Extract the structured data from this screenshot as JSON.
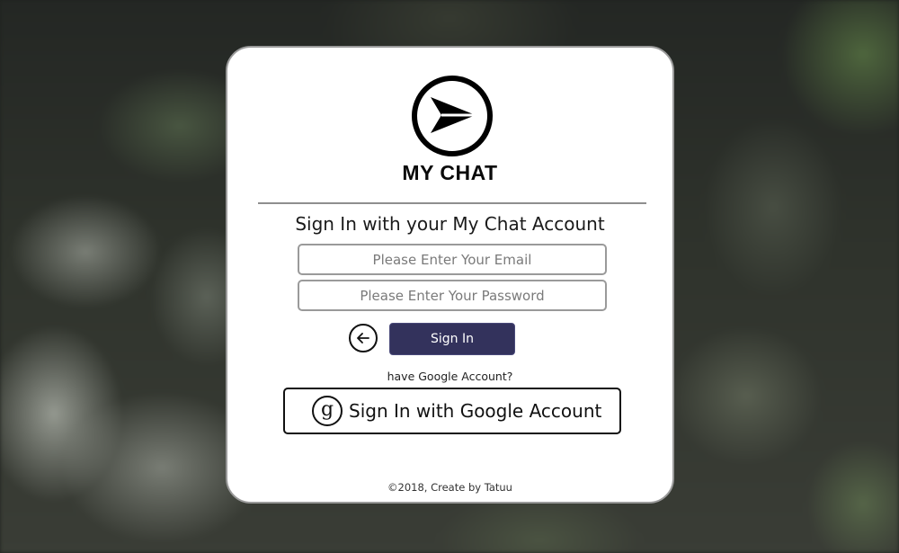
{
  "app": {
    "brand_name": "MY CHAT",
    "logo_icon": "send-arrow-icon"
  },
  "login": {
    "heading": "Sign In with your My Chat Account",
    "email_placeholder": "Please Enter Your Email",
    "email_value": "",
    "password_placeholder": "Please Enter Your Password",
    "password_value": "",
    "back_icon": "arrow-left-icon",
    "signin_label": "Sign In",
    "google_hint": "have Google Account?",
    "google_icon": "google-g-icon",
    "google_icon_glyph": "g",
    "google_label": "Sign In with Google Account"
  },
  "footer": {
    "text": "©2018, Create by Tatuu"
  },
  "colors": {
    "signin_button": "#33325c",
    "card_background": "#ffffff",
    "card_border": "#9a9a9a"
  }
}
